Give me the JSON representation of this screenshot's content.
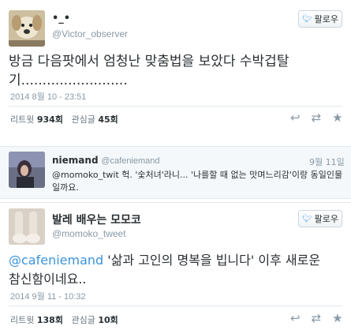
{
  "tweet1": {
    "display_name": "•_•",
    "handle": "@Victor_observer",
    "follow_label": "팔로우",
    "text_line1": "방금 다음팟에서 엄청난 맞춤법을 보았다 수박겁탈",
    "text_line2": "기.........................",
    "timestamp": "2014 8월 10 - 23:51",
    "retweets_label": "리트윗",
    "retweets_count": "934회",
    "likes_label": "관심글",
    "likes_count": "45회"
  },
  "reply": {
    "display_name": "niemand",
    "handle": "@cafeniemand",
    "date": "9월 11일",
    "mention": "@momoko_twit",
    "text_line1_rest": " 헉. '숯처녀'라니... '나를할 때 없는 맛며느리감'이랑 동일인물",
    "text_line2": "일까요."
  },
  "tweet3": {
    "display_name": "발레 배우는 모모코",
    "handle": "@momoko_tweet",
    "follow_label": "팔로우",
    "mention": "@cafeniemand",
    "text_line1_rest": " '삶과 고인의 명복을 빕니다' 이후 새로운",
    "text_line2": "참신함이네요..",
    "timestamp": "2014 9월 11 - 10:32",
    "retweets_label": "리트윗",
    "retweets_count": "138회",
    "likes_label": "관심글",
    "likes_count": "10회"
  },
  "icons": {
    "reply": "reply-icon",
    "retweet": "retweet-icon",
    "favorite": "star-icon",
    "twitter_bird": "twitter-bird-icon"
  },
  "colors": {
    "link": "#3b94d9",
    "muted": "#8899a6",
    "bird": "#55acee"
  }
}
